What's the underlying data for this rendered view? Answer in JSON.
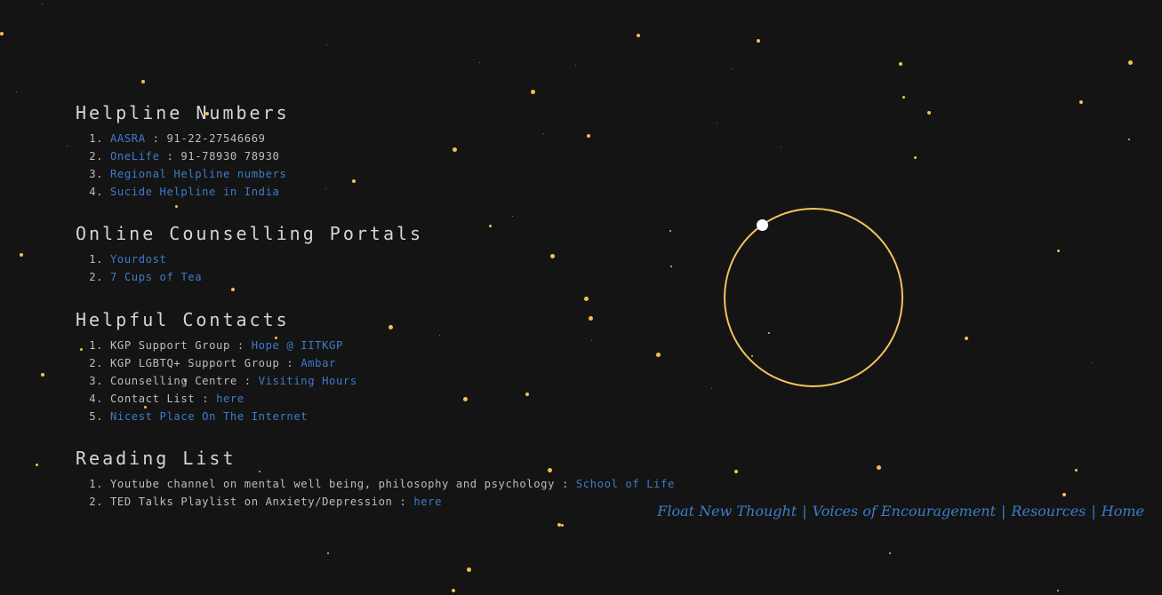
{
  "sections": {
    "helpline": {
      "title": "Helpline Numbers",
      "items": [
        {
          "link": "AASRA",
          "text": " : 91-22-27546669"
        },
        {
          "link": "OneLife",
          "text": " : 91-78930 78930"
        },
        {
          "link": "Regional Helpline numbers",
          "text": ""
        },
        {
          "link": "Sucide Helpline in India",
          "text": ""
        }
      ]
    },
    "portals": {
      "title": "Online Counselling Portals",
      "items": [
        {
          "link": "Yourdost"
        },
        {
          "link": "7 Cups of Tea"
        }
      ]
    },
    "contacts": {
      "title": "Helpful Contacts",
      "items": [
        {
          "text": "KGP Support Group : ",
          "link": "Hope @ IITKGP"
        },
        {
          "text": "KGP LGBTQ+ Support Group : ",
          "link": "Ambar"
        },
        {
          "text": "Counselling Centre : ",
          "link": "Visiting Hours"
        },
        {
          "text": "Contact List : ",
          "link": "here"
        },
        {
          "text": "",
          "link": "Nicest Place On The Internet"
        }
      ]
    },
    "reading": {
      "title": "Reading List",
      "items": [
        {
          "text": "Youtube channel on mental well being, philosophy and psychology : ",
          "link": "School of Life"
        },
        {
          "text": "TED Talks Playlist on Anxiety/Depression : ",
          "link": "here"
        }
      ]
    }
  },
  "nav": {
    "float": "Float New Thought",
    "voices": "Voices of Encouragement",
    "resources": "Resources",
    "home": "Home",
    "separator": "|"
  },
  "colors": {
    "background": "#141414",
    "link": "#3d7cc9",
    "star": "#f2c14e",
    "orbit": "#f2c55c"
  }
}
